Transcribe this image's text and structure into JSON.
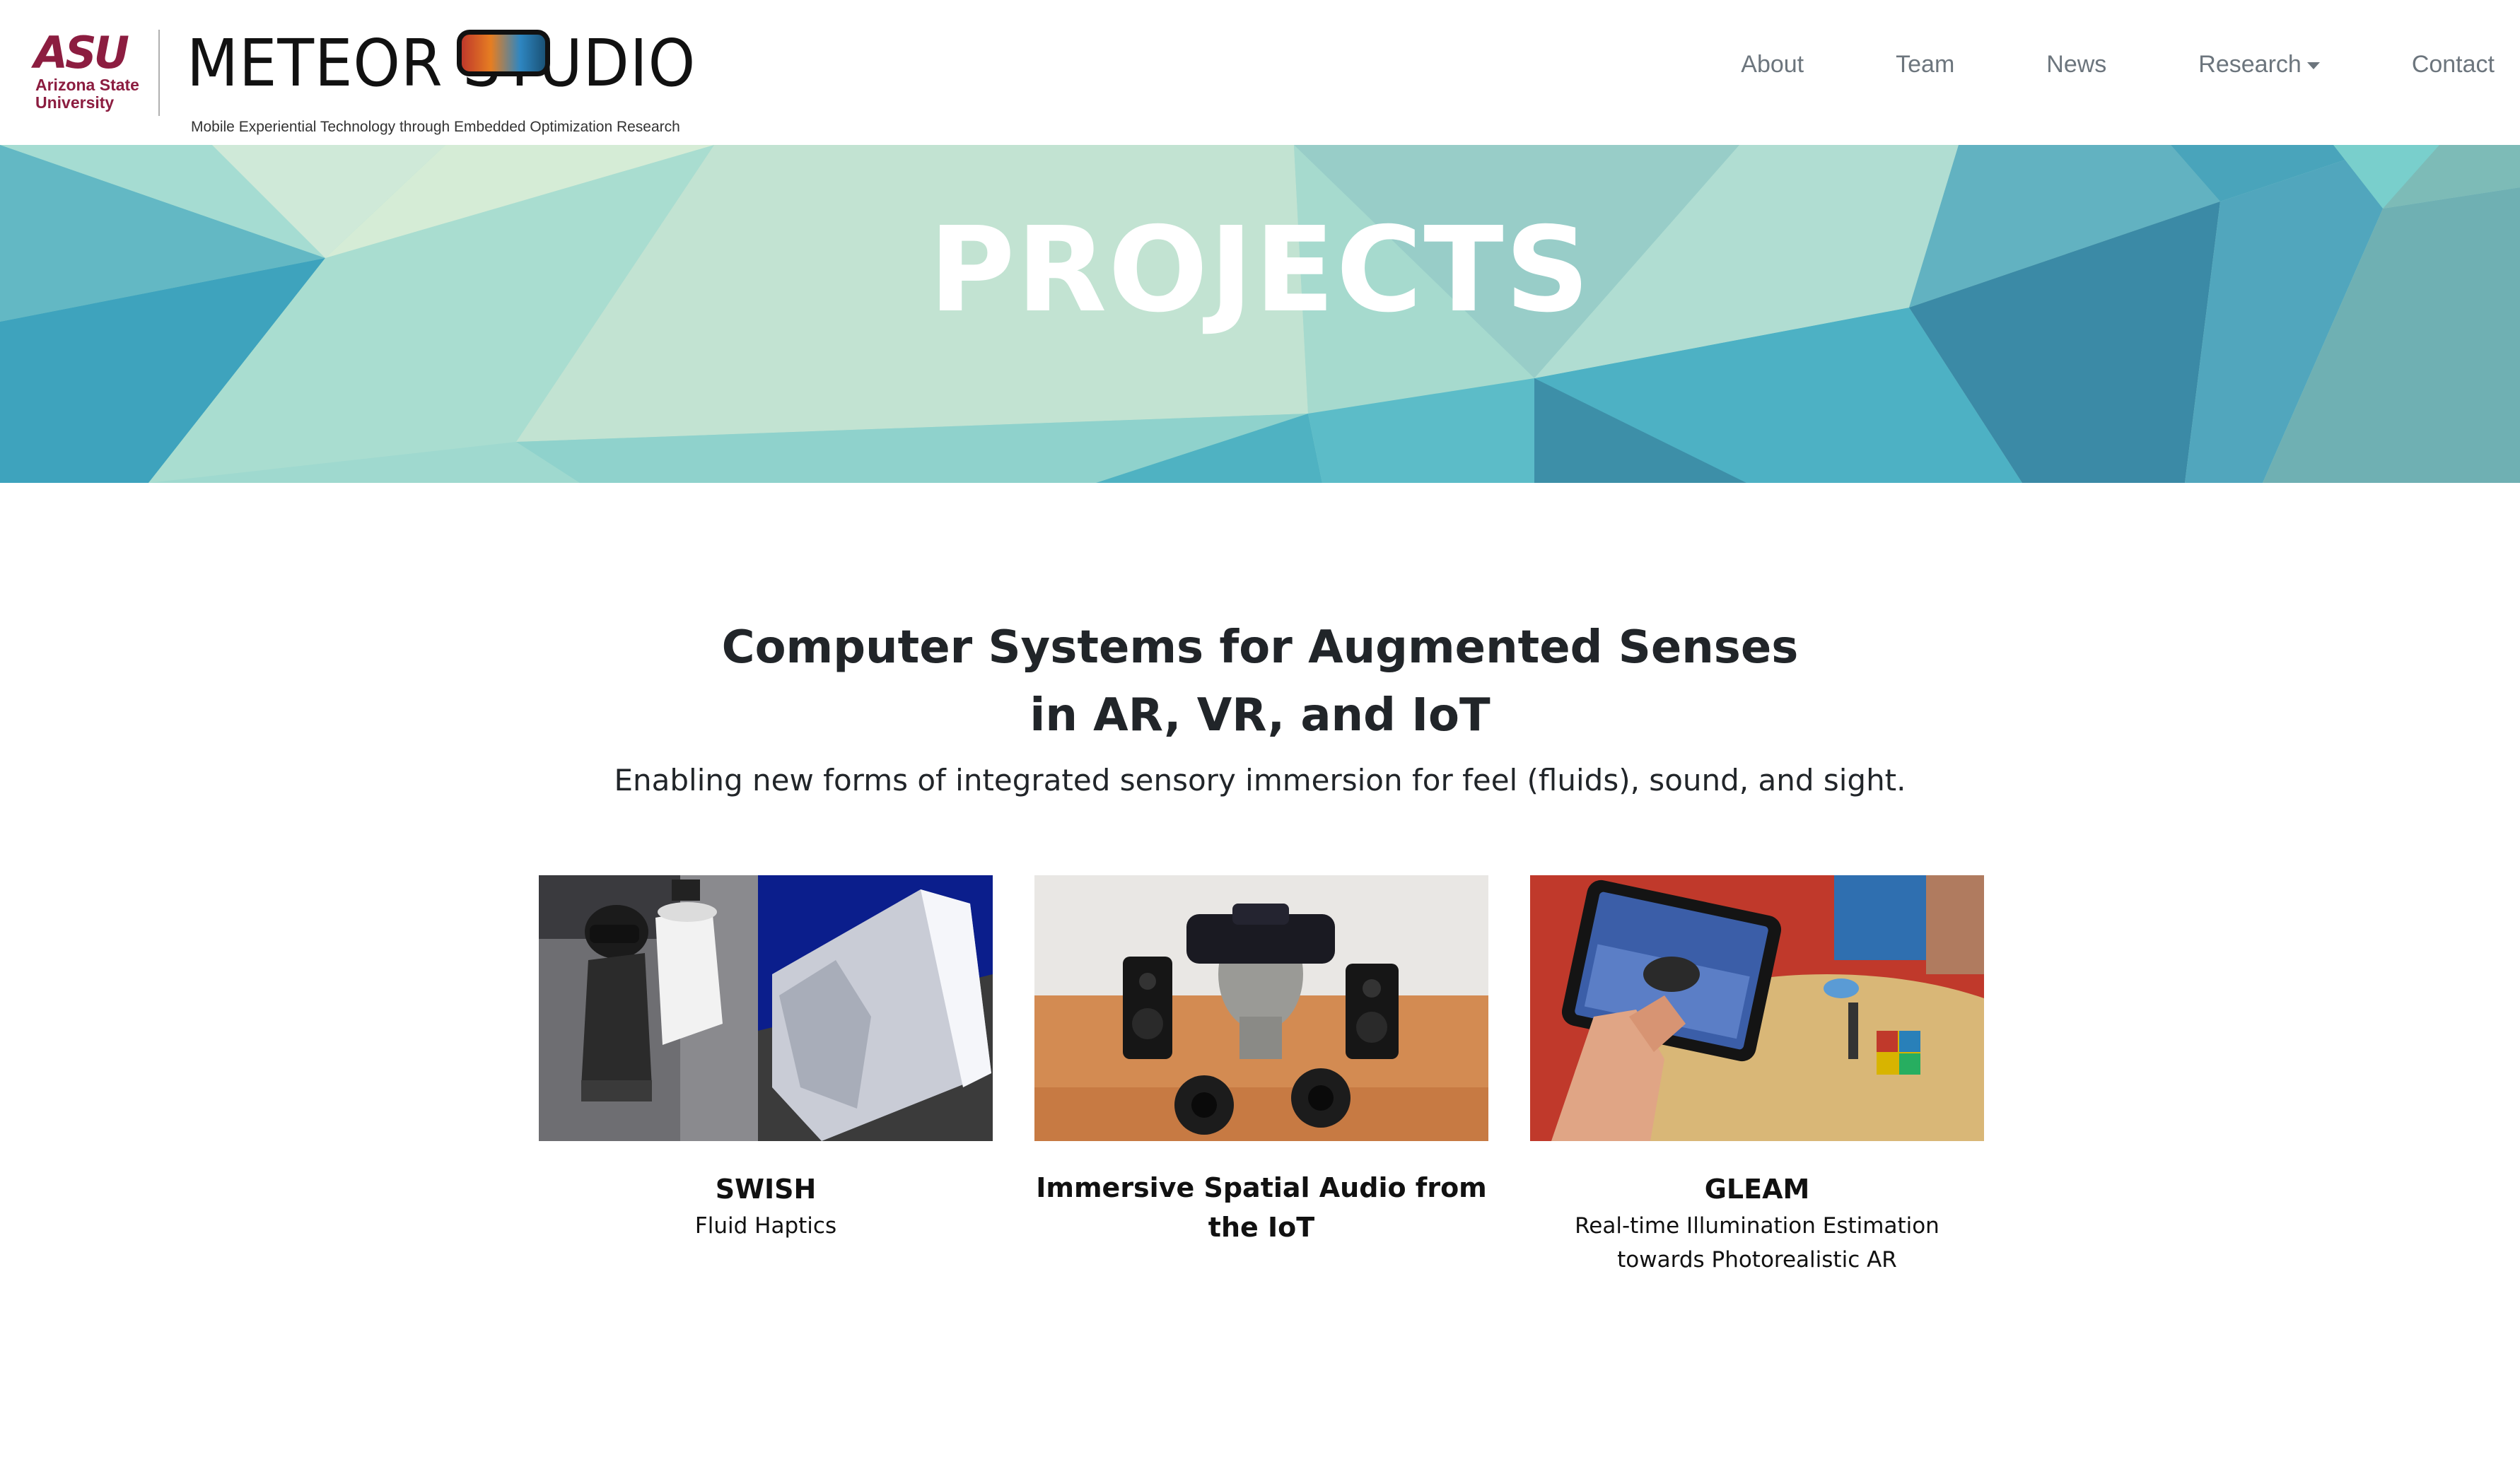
{
  "brand": {
    "asu_mark": "ASU",
    "asu_name": "Arizona State University",
    "title": "METEOR STUDIO",
    "tagline": "Mobile Experiential Technology through Embedded Optimization Research"
  },
  "nav": {
    "items": [
      {
        "label": "About"
      },
      {
        "label": "Team"
      },
      {
        "label": "News"
      },
      {
        "label": "Research",
        "has_dropdown": true
      },
      {
        "label": "Contact"
      }
    ]
  },
  "hero": {
    "title": "PROJECTS"
  },
  "intro": {
    "heading_line1": "Computer Systems for Augmented Senses",
    "heading_line2": "in AR, VR, and IoT",
    "subheading": "Enabling new forms of integrated sensory immersion for feel (fluids), sound, and sight."
  },
  "projects": [
    {
      "title": "SWISH",
      "description": "Fluid Haptics"
    },
    {
      "title": "Immersive Spatial Audio from the IoT",
      "description": ""
    },
    {
      "title": "GLEAM",
      "description": "Real-time Illumination Estimation towards Photorealistic AR"
    }
  ],
  "colors": {
    "asu_maroon": "#8c1d40",
    "asu_gold": "#ffc627",
    "nav_text": "#6c757d",
    "heading_text": "#212529"
  }
}
